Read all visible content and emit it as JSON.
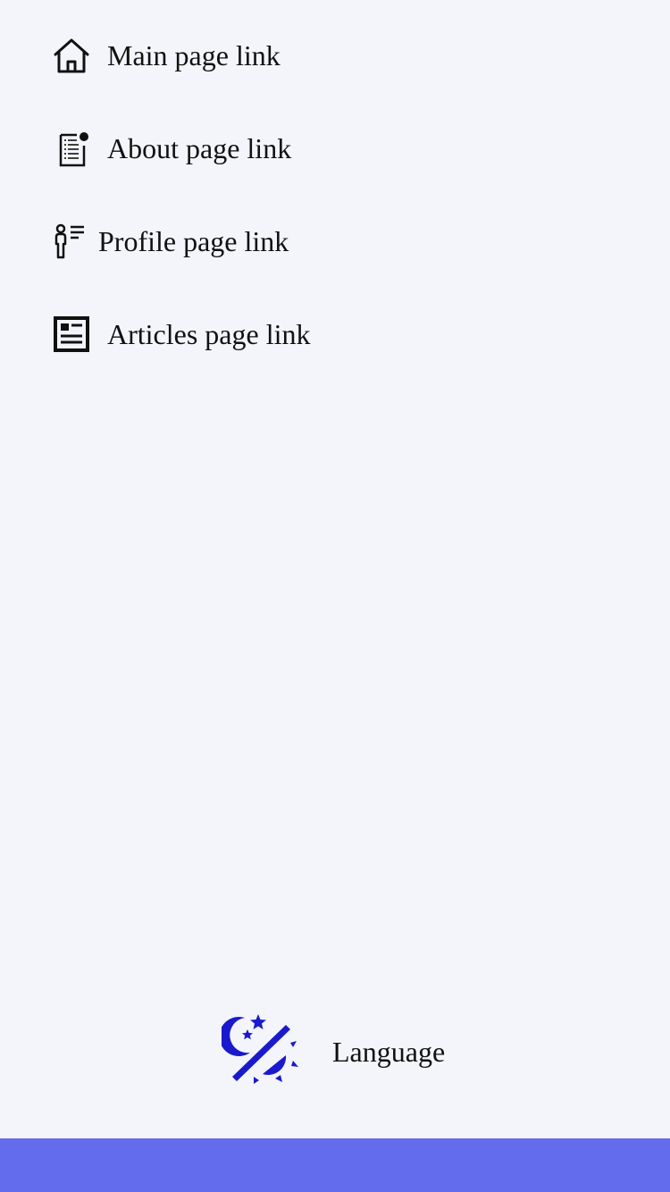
{
  "nav": {
    "items": [
      {
        "label": "Main page link",
        "icon": "home-icon"
      },
      {
        "label": "About page link",
        "icon": "about-document-icon"
      },
      {
        "label": "Profile page link",
        "icon": "profile-icon"
      },
      {
        "label": "Articles page link",
        "icon": "articles-icon"
      }
    ]
  },
  "footer": {
    "theme_toggle_icon": "theme-toggle-icon",
    "language_label": "Language"
  },
  "colors": {
    "background": "#f4f5fa",
    "text": "#111111",
    "accent": "#1a1acc",
    "bottom_bar": "#636ced"
  }
}
